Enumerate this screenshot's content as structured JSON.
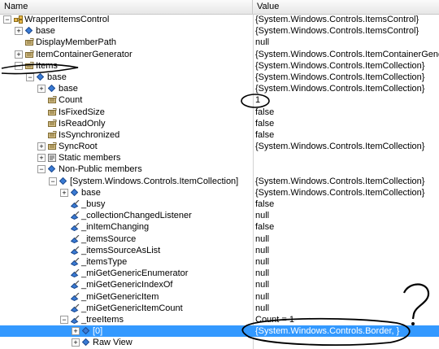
{
  "columns": {
    "name": "Name",
    "value": "Value"
  },
  "rows": [
    {
      "name": "WrapperItemsControl",
      "value": "{System.Windows.Controls.ItemsControl}"
    },
    {
      "name": "base",
      "value": "{System.Windows.Controls.ItemsControl}"
    },
    {
      "name": "DisplayMemberPath",
      "value": "null"
    },
    {
      "name": "ItemContainerGenerator",
      "value": "{System.Windows.Controls.ItemContainerGenerator}"
    },
    {
      "name": "Items",
      "value": "{System.Windows.Controls.ItemCollection}"
    },
    {
      "name": "base",
      "value": "{System.Windows.Controls.ItemCollection}"
    },
    {
      "name": "base",
      "value": "{System.Windows.Controls.ItemCollection}"
    },
    {
      "name": "Count",
      "value": "1"
    },
    {
      "name": "IsFixedSize",
      "value": "false"
    },
    {
      "name": "IsReadOnly",
      "value": "false"
    },
    {
      "name": "IsSynchronized",
      "value": "false"
    },
    {
      "name": "SyncRoot",
      "value": "{System.Windows.Controls.ItemCollection}"
    },
    {
      "name": "Static members",
      "value": ""
    },
    {
      "name": "Non-Public members",
      "value": ""
    },
    {
      "name": "[System.Windows.Controls.ItemCollection]",
      "value": "{System.Windows.Controls.ItemCollection}"
    },
    {
      "name": "base",
      "value": "{System.Windows.Controls.ItemCollection}"
    },
    {
      "name": "_busy",
      "value": "false"
    },
    {
      "name": "_collectionChangedListener",
      "value": "null"
    },
    {
      "name": "_inItemChanging",
      "value": "false"
    },
    {
      "name": "_itemsSource",
      "value": "null"
    },
    {
      "name": "_itemsSourceAsList",
      "value": "null"
    },
    {
      "name": "_itemsType",
      "value": "null"
    },
    {
      "name": "_miGetGenericEnumerator",
      "value": "null"
    },
    {
      "name": "_miGetGenericIndexOf",
      "value": "null"
    },
    {
      "name": "_miGetGenericItem",
      "value": "null"
    },
    {
      "name": "_miGetGenericItemCount",
      "value": "null"
    },
    {
      "name": "_treeItems",
      "value": "Count = 1"
    },
    {
      "name": "[0]",
      "value": "{System.Windows.Controls.Border, }"
    },
    {
      "name": "Raw View",
      "value": ""
    }
  ],
  "annotation": {
    "question_mark": "?",
    "count_highlight": "1"
  }
}
